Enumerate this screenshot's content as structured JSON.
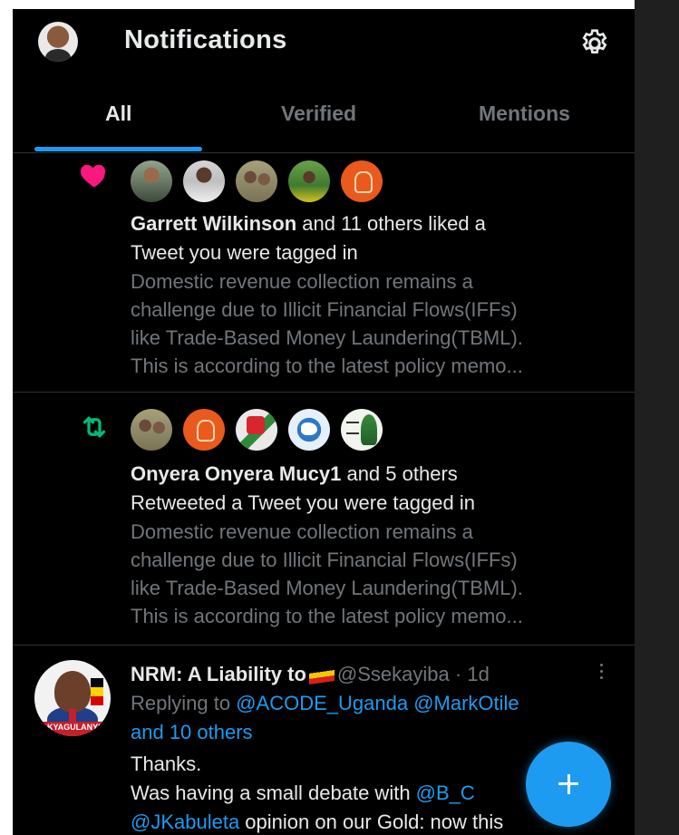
{
  "header": {
    "title": "Notifications",
    "avatar": "profile-avatar",
    "settings_icon": "gear-icon"
  },
  "tabs": [
    {
      "label": "All",
      "active": true
    },
    {
      "label": "Verified",
      "active": false
    },
    {
      "label": "Mentions",
      "active": false
    }
  ],
  "notifications": [
    {
      "kind": "like",
      "icon": "heart-icon",
      "actor": "Garrett Wilkinson",
      "action_line1": " and 11 others liked a",
      "action_line2": "Tweet you were tagged in",
      "preview": [
        "Domestic revenue collection remains a",
        "challenge due to Illicit Financial Flows(IFFs)",
        "like Trade-Based Money Laundering(TBML).",
        "This is according to the latest policy memo..."
      ]
    },
    {
      "kind": "retweet",
      "icon": "retweet-icon",
      "actor": "Onyera Onyera Mucy1",
      "action_line1": " and 5 others",
      "action_line2": "Retweeted a Tweet you were tagged in",
      "preview": [
        "Domestic revenue collection remains a",
        "challenge due to Illicit Financial Flows(IFFs)",
        "like Trade-Based Money Laundering(TBML).",
        "This is according to the latest policy memo..."
      ]
    }
  ],
  "tweet": {
    "display_name": "NRM: A Liability to",
    "flag_icon": "uganda-flag-icon",
    "handle": "@Ssekayiba",
    "time": "· 1d",
    "avatar_banner": "KYAGULANYI",
    "replying_prefix": "Replying to ",
    "replying_to": [
      "@ACODE_Uganda",
      "@MarkOtile"
    ],
    "replying_more": "and 10 others",
    "body_line1": "Thanks.",
    "body_line2_text": "Was having a small debate with ",
    "body_line2_mention": "@B_C",
    "body_line3_mention": "@JKabuleta",
    "body_line3_text": " opinion on our Gold: now this"
  },
  "fab": {
    "icon": "plus-icon"
  },
  "colors": {
    "background": "#000000",
    "accent": "#1d9bf0",
    "like": "#f91880",
    "retweet": "#00ba7c",
    "muted": "#71767b"
  }
}
